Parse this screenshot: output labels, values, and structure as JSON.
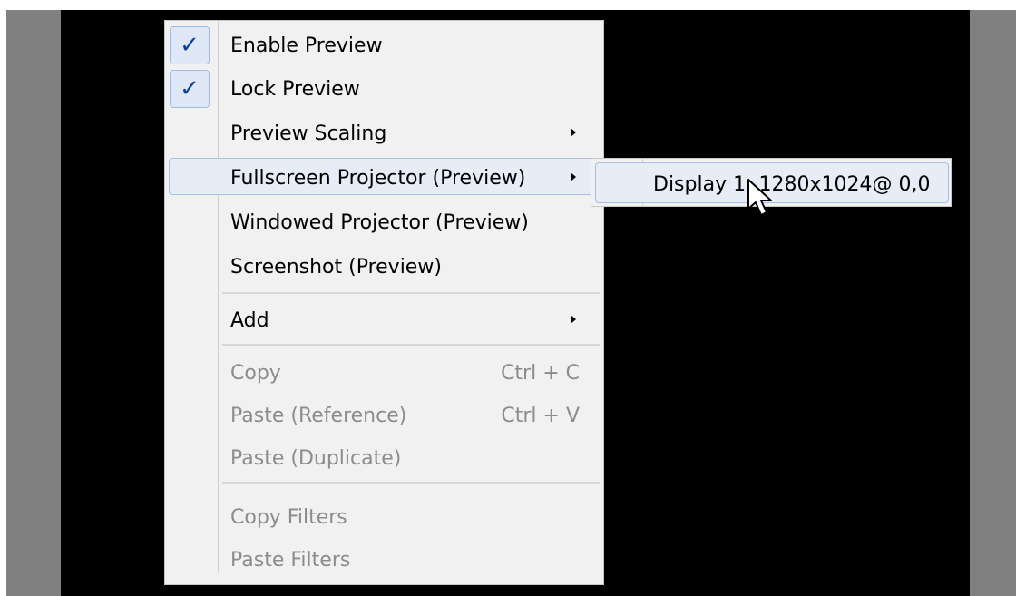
{
  "context_menu": {
    "items": [
      {
        "label": "Enable Preview",
        "checked": true
      },
      {
        "label": "Lock Preview",
        "checked": true
      },
      {
        "label": "Preview Scaling",
        "submenu": true
      },
      {
        "label": "Fullscreen Projector (Preview)",
        "submenu": true,
        "highlighted": true
      },
      {
        "label": "Windowed Projector (Preview)"
      },
      {
        "label": "Screenshot (Preview)"
      },
      {
        "label": "Add",
        "submenu": true
      },
      {
        "label": "Copy",
        "shortcut": "Ctrl + C",
        "disabled": true
      },
      {
        "label": "Paste (Reference)",
        "shortcut": "Ctrl + V",
        "disabled": true
      },
      {
        "label": "Paste (Duplicate)",
        "disabled": true
      },
      {
        "label": "Copy Filters",
        "disabled": true
      },
      {
        "label": "Paste Filters",
        "disabled": true
      }
    ]
  },
  "submenu": {
    "items": [
      {
        "label": "Display 1: 1280x1024@ 0,0",
        "highlighted": true
      }
    ]
  },
  "colors": {
    "menu_background": "#f1f1f1",
    "highlight_fill": "#e7edf7",
    "highlight_border": "#a9c0e4",
    "check_color": "#0c3fa8",
    "disabled_text": "#8c8c8c",
    "preview_background": "#000000",
    "window_background": "#808080"
  },
  "icons": {
    "check": "check-icon",
    "submenu_arrow": "submenu-arrow-icon",
    "cursor": "mouse-pointer-icon"
  }
}
